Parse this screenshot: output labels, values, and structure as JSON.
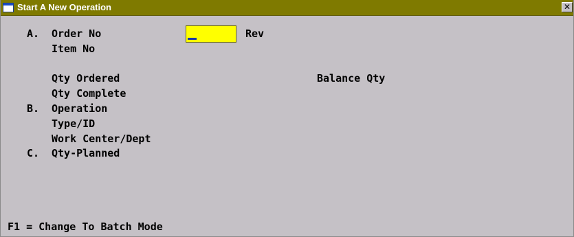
{
  "window": {
    "title": "Start A New Operation",
    "close_glyph": "✕"
  },
  "form": {
    "section_a": "A.",
    "order_no_label": "Order No",
    "order_no_value": "",
    "rev_label": "Rev",
    "item_no_label": "Item No",
    "qty_ordered_label": "Qty Ordered",
    "balance_qty_label": "Balance Qty",
    "qty_complete_label": "Qty Complete",
    "section_b": "B.",
    "operation_label": "Operation",
    "type_id_label": "Type/ID",
    "work_center_label": "Work Center/Dept",
    "section_c": "C.",
    "qty_planned_label": "Qty-Planned"
  },
  "footer": {
    "hint": "F1 = Change To Batch Mode"
  },
  "colors": {
    "titlebar": "#7f7a00",
    "background": "#c5c1c6",
    "input_bg": "#ffff00",
    "cursor": "#1a3aa8"
  },
  "icons": {
    "window": "window-app-icon",
    "close": "close-icon"
  }
}
